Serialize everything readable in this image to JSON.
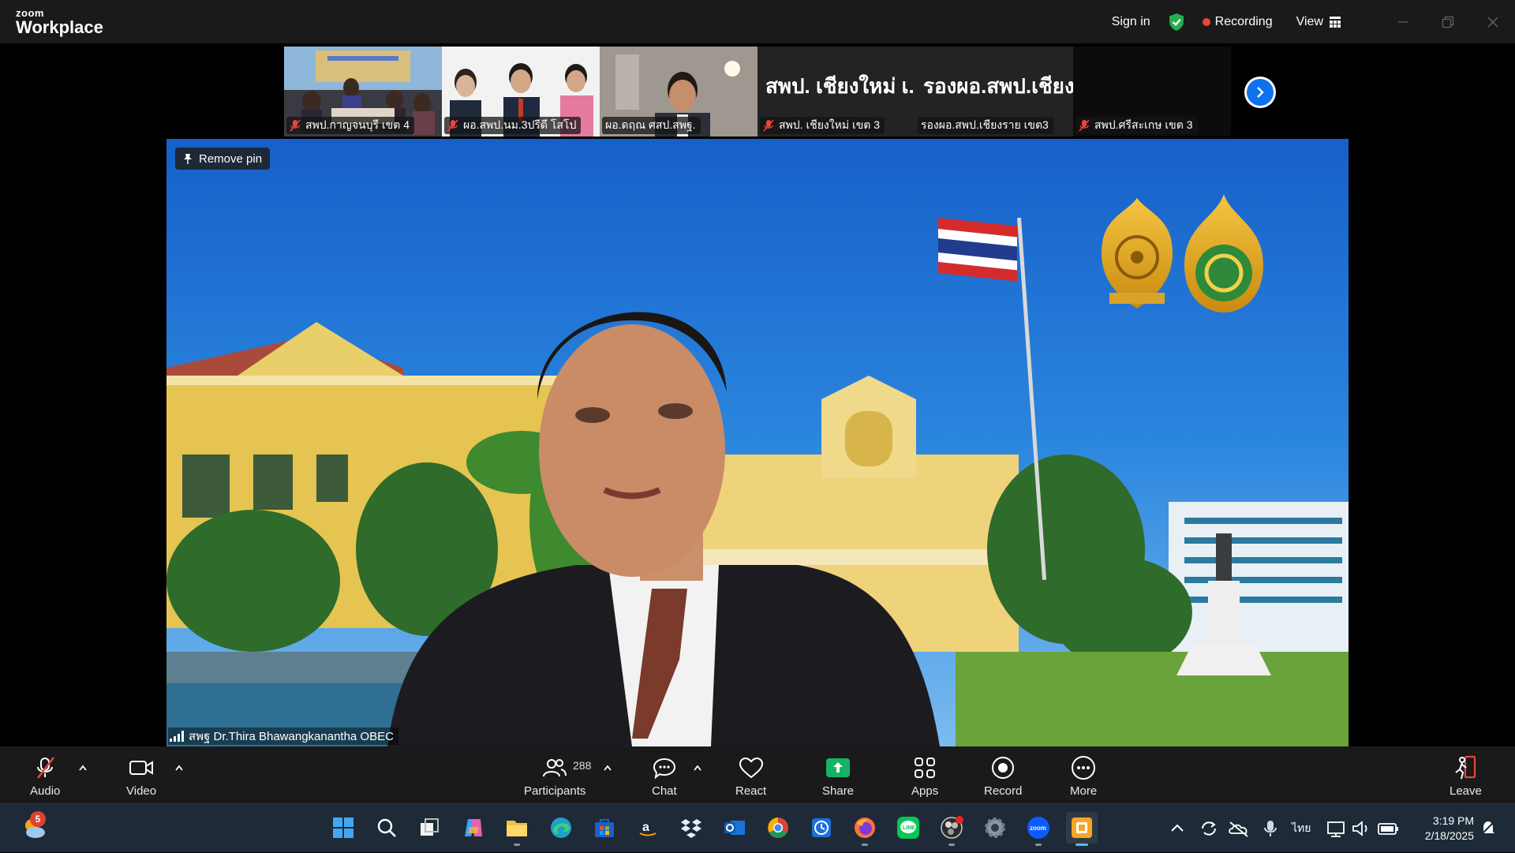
{
  "app": {
    "brand_small": "zoom",
    "brand_big": "Workplace"
  },
  "titlebar": {
    "sign_in": "Sign in",
    "recording": "Recording",
    "view": "View"
  },
  "gallery": {
    "tiles": [
      {
        "name": "สพป.กาญจนบุรี เขต 4",
        "muted": true,
        "has_video": true
      },
      {
        "name": "ผอ.สพป.นม.3ปรีดี โสโป",
        "muted": true,
        "has_video": true
      },
      {
        "name": "ผอ.ดฤณ ศสป.สพฐ.",
        "muted": false,
        "has_video": true
      },
      {
        "name": "สพป. เชียงใหม่ เขต 3",
        "display_name": "สพป. เชียงใหม่ เ...",
        "muted": true,
        "has_video": false
      },
      {
        "name": "รองผอ.สพป.เชียงราย เขต3",
        "display_name": "รองผอ.สพป.เชียง...",
        "muted": false,
        "has_video": false
      },
      {
        "name": "สพป.ศรีสะเกษ เขต 3",
        "display_name": "",
        "muted": true,
        "has_video": false
      }
    ]
  },
  "main_video": {
    "remove_pin": "Remove pin",
    "speaker_name": "สพฐ Dr.Thira Bhawangkanantha OBEC"
  },
  "toolbar": {
    "audio": "Audio",
    "video": "Video",
    "participants": "Participants",
    "participants_count": "288",
    "chat": "Chat",
    "react": "React",
    "share": "Share",
    "apps": "Apps",
    "record": "Record",
    "more": "More",
    "leave": "Leave"
  },
  "taskbar": {
    "weather_badge": "5",
    "apps": [
      "start-icon",
      "search-icon",
      "task-view-icon",
      "copilot-icon",
      "file-explorer-icon",
      "edge-icon",
      "store-icon",
      "amazon-icon",
      "dropbox-icon",
      "outlook-icon",
      "chrome-icon",
      "clock-app-icon",
      "firefox-icon",
      "line-icon",
      "obs-icon",
      "settings-icon",
      "zoom-icon",
      "vlc-icon"
    ],
    "language": "ไทย",
    "time": "3:19 PM",
    "date": "2/18/2025"
  },
  "colors": {
    "accent": "#0e72ed",
    "share_green": "#16b364",
    "recording_red": "#e8453c",
    "leave_red": "#e8453c"
  }
}
